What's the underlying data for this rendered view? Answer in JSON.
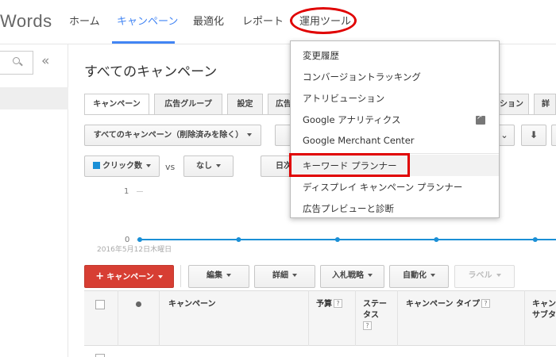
{
  "header": {
    "brand": "Words",
    "tabs": [
      "ホーム",
      "キャンペーン",
      "最適化",
      "レポート",
      "運用ツール"
    ],
    "active_tab_color": "#4285f4",
    "annotation_color": "#e00000"
  },
  "sidebar": {
    "collapse_glyph": "«"
  },
  "page": {
    "title": "すべてのキャンペーン"
  },
  "tabs": [
    "キャンペーン",
    "広告グループ",
    "設定",
    "広告",
    "",
    "ション",
    "詳"
  ],
  "toolbar": {
    "filter_label": "すべてのキャンペーン（削除済みを除く）",
    "metric_label": "クリック数",
    "metric_color": "#1a8fd6",
    "vs_label": "vs",
    "compare_label": "なし",
    "date_partial": "日次"
  },
  "chart_data": {
    "type": "line",
    "x": [
      "2016年5月12日木曜日"
    ],
    "series": [
      {
        "values": [
          0,
          0,
          0,
          0,
          0
        ]
      }
    ],
    "yticks": [
      0,
      1
    ],
    "ylim": [
      0,
      1
    ]
  },
  "actions": {
    "add_campaign": "キャンペーン",
    "edit": "編集",
    "details": "詳細",
    "bid_strategy": "入札戦略",
    "automate": "自動化",
    "labels": "ラベル"
  },
  "table": {
    "columns": [
      "キャンペーン",
      "予算",
      "ステー\nタス",
      "キャンペーン タイプ",
      "キャン\nサブタ"
    ],
    "help_glyph": "?"
  },
  "menu": {
    "items": [
      "変更履歴",
      "コンバージョントラッキング",
      "アトリビューション",
      "Google アナリティクス",
      "Google Merchant Center",
      "キーワード プランナー",
      "ディスプレイ キャンペーン プランナー",
      "広告プレビューと診断"
    ]
  }
}
